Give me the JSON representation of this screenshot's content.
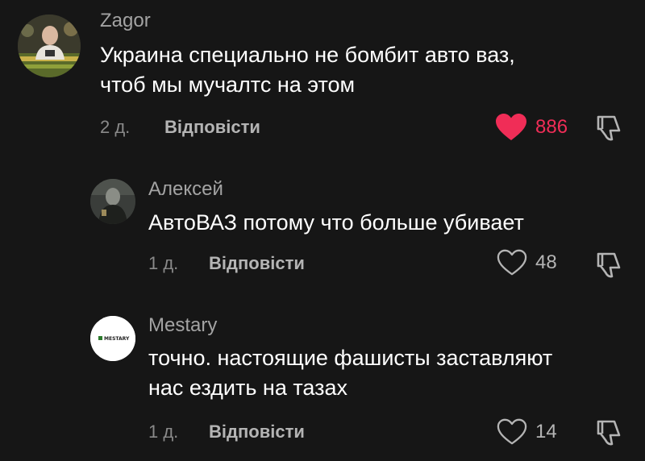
{
  "colors": {
    "background": "#161616",
    "liked_heart": "#f02d57",
    "muted_text": "#a3a3a3"
  },
  "comments": [
    {
      "author": "Zagor",
      "text_lines": [
        "Украина специально не бомбит авто ваз,",
        "чтоб мы мучалтс на этом"
      ],
      "time": "2 д.",
      "reply_label": "Відповісти",
      "likes": "886",
      "liked": true,
      "like_icon": "heart-filled-icon",
      "dislike_icon": "thumbs-down-icon"
    },
    {
      "author": "Алексей",
      "text_lines": [
        "АвтоВАЗ потому что больше убивает"
      ],
      "time": "1 д.",
      "reply_label": "Відповісти",
      "likes": "48",
      "liked": false,
      "like_icon": "heart-outline-icon",
      "dislike_icon": "thumbs-down-icon"
    },
    {
      "author": "Mestary",
      "avatar_logo_text": "MESTARY",
      "text_lines": [
        "точно. настоящие фашисты заставляют",
        "нас ездить на тазах"
      ],
      "time": "1 д.",
      "reply_label": "Відповісти",
      "likes": "14",
      "liked": false,
      "like_icon": "heart-outline-icon",
      "dislike_icon": "thumbs-down-icon"
    }
  ]
}
